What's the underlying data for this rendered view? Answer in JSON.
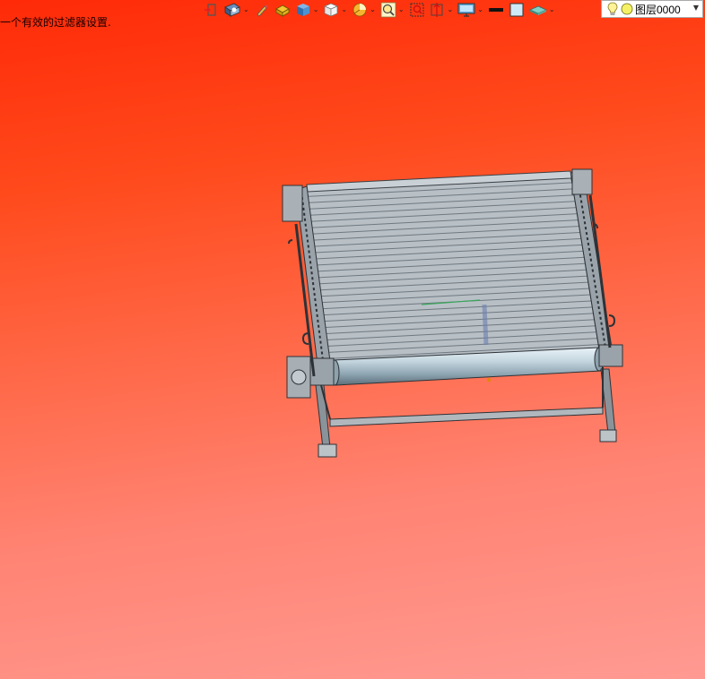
{
  "status": {
    "message": "一个有效的过滤器设置."
  },
  "toolbar": {
    "items": [
      {
        "icon": "view-orient-icon",
        "has_dropdown": false
      },
      {
        "icon": "display-style-icon",
        "has_dropdown": true
      },
      {
        "icon": "pencil-icon",
        "has_dropdown": false
      },
      {
        "icon": "apply-scene-icon",
        "has_dropdown": false
      },
      {
        "icon": "shaded-cube-icon",
        "has_dropdown": true
      },
      {
        "icon": "white-cube-icon",
        "has_dropdown": true
      },
      {
        "icon": "section-view-icon",
        "has_dropdown": true
      },
      {
        "icon": "zoom-fit-icon",
        "has_dropdown": true
      },
      {
        "icon": "zoom-box-icon",
        "has_dropdown": false
      },
      {
        "icon": "previous-view-icon",
        "has_dropdown": true
      },
      {
        "icon": "monitor-view-icon",
        "has_dropdown": true
      },
      {
        "icon": "line-color-icon",
        "has_dropdown": false
      },
      {
        "icon": "fill-color-icon",
        "has_dropdown": false
      },
      {
        "icon": "layer-visibility-icon",
        "has_dropdown": true
      }
    ]
  },
  "layer": {
    "current": "图层0000"
  },
  "colors": {
    "background_top": "#ff2a08",
    "background_bottom": "#ff9a92",
    "model_gray": "#b4bcc2",
    "model_dark": "#3a3f44"
  }
}
